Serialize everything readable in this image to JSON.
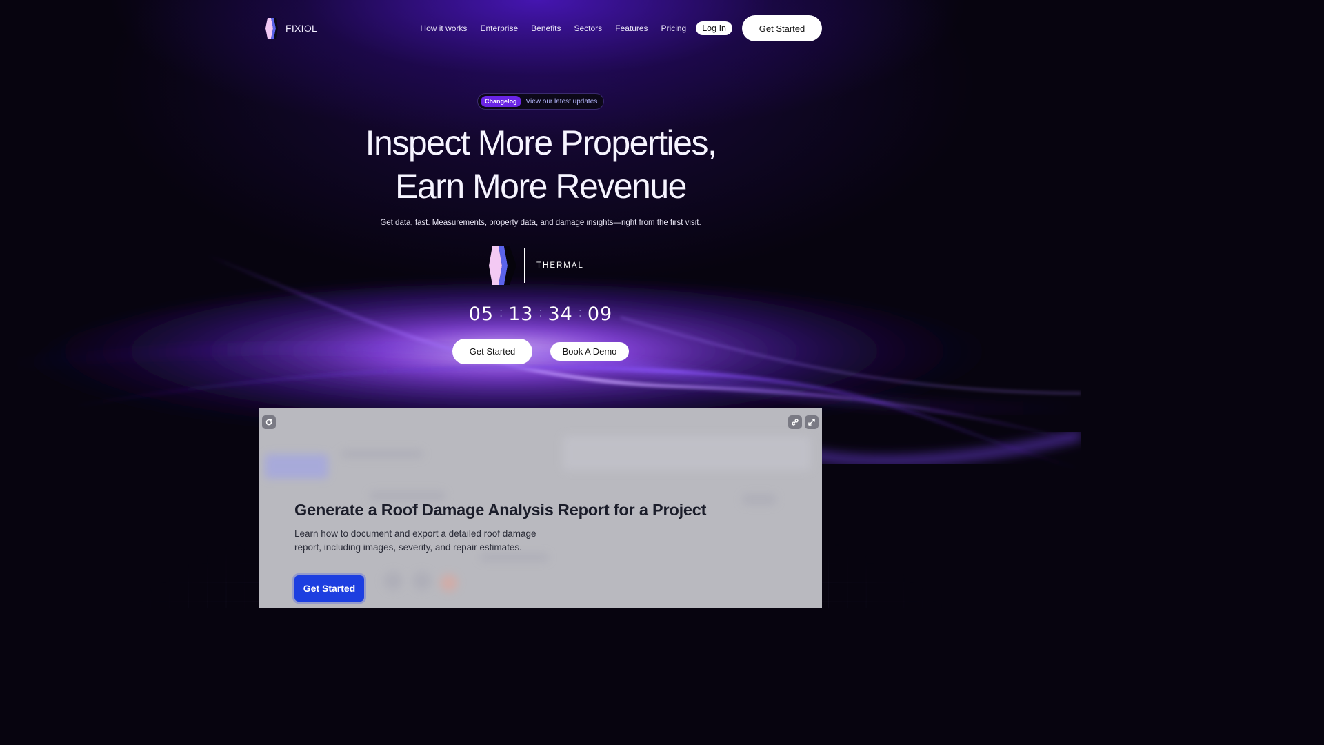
{
  "brand": {
    "name": "FIXIOL"
  },
  "nav": {
    "links": [
      "How it works",
      "Enterprise",
      "Benefits",
      "Sectors",
      "Features",
      "Pricing"
    ],
    "login_label": "Log In",
    "cta_label": "Get Started"
  },
  "changelog": {
    "badge": "Changelog",
    "text": "View our latest updates"
  },
  "hero": {
    "title_line1": "Inspect More Properties,",
    "title_line2": "Earn More Revenue",
    "subtitle": "Get data, fast. Measurements, property data, and damage insights—right from the first visit."
  },
  "thermal": {
    "label": "THERMAL"
  },
  "countdown": {
    "days": "05",
    "hours": "13",
    "minutes": "34",
    "seconds": "09",
    "separator": ":"
  },
  "hero_ctas": {
    "primary": "Get Started",
    "secondary": "Book A Demo"
  },
  "panel": {
    "heading": "Generate a Roof Damage Analysis Report for a Project",
    "description": "Learn how to document and export a detailed roof damage report, including images, severity, and repair estimates.",
    "cta_label": "Get Started",
    "icons": {
      "refresh": "refresh-icon",
      "link": "link-icon",
      "expand": "expand-icon"
    }
  },
  "colors": {
    "accent_purple": "#6a25e6",
    "panel_cta_blue": "#1d3fe0",
    "background": "#07040f"
  }
}
